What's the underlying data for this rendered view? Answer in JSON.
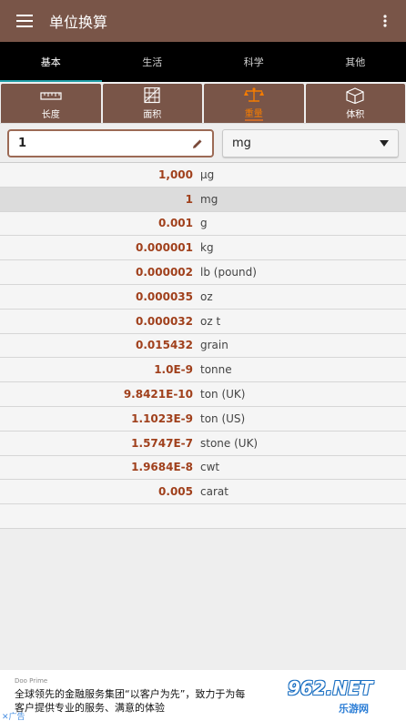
{
  "appbar": {
    "title": "单位换算"
  },
  "tabs": [
    {
      "label": "基本"
    },
    {
      "label": "生活"
    },
    {
      "label": "科学"
    },
    {
      "label": "其他"
    }
  ],
  "subtabs": [
    {
      "label": "长度",
      "icon": "ruler-icon"
    },
    {
      "label": "面积",
      "icon": "grid-square-icon"
    },
    {
      "label": "重量",
      "icon": "scale-icon"
    },
    {
      "label": "体积",
      "icon": "cube-icon"
    }
  ],
  "input": {
    "value": "1",
    "unit": "mg"
  },
  "results": [
    {
      "value": "1,000",
      "unit": "μg"
    },
    {
      "value": "1",
      "unit": "mg"
    },
    {
      "value": "0.001",
      "unit": "g"
    },
    {
      "value": "0.000001",
      "unit": "kg"
    },
    {
      "value": "0.000002",
      "unit": "lb (pound)"
    },
    {
      "value": "0.000035",
      "unit": "oz"
    },
    {
      "value": "0.000032",
      "unit": "oz t"
    },
    {
      "value": "0.015432",
      "unit": "grain"
    },
    {
      "value": "1.0E-9",
      "unit": "tonne"
    },
    {
      "value": "9.8421E-10",
      "unit": "ton (UK)"
    },
    {
      "value": "1.1023E-9",
      "unit": "ton (US)"
    },
    {
      "value": "1.5747E-7",
      "unit": "stone (UK)"
    },
    {
      "value": "1.9684E-8",
      "unit": "cwt"
    },
    {
      "value": "0.005",
      "unit": "carat"
    }
  ],
  "ad": {
    "brand": "Doo Prime",
    "line1": "全球领先的金融服务集团“以客户为先”，致力于为每",
    "line2": "客户提供专业的服务、满意的体验",
    "close": "✕广告",
    "watermark": "962.NET",
    "watermark_sub": "乐游网"
  },
  "colors": {
    "brand": "#795548",
    "accent": "#f57c00",
    "value": "#a0401c",
    "tab_indicator": "#1f9ea6"
  }
}
